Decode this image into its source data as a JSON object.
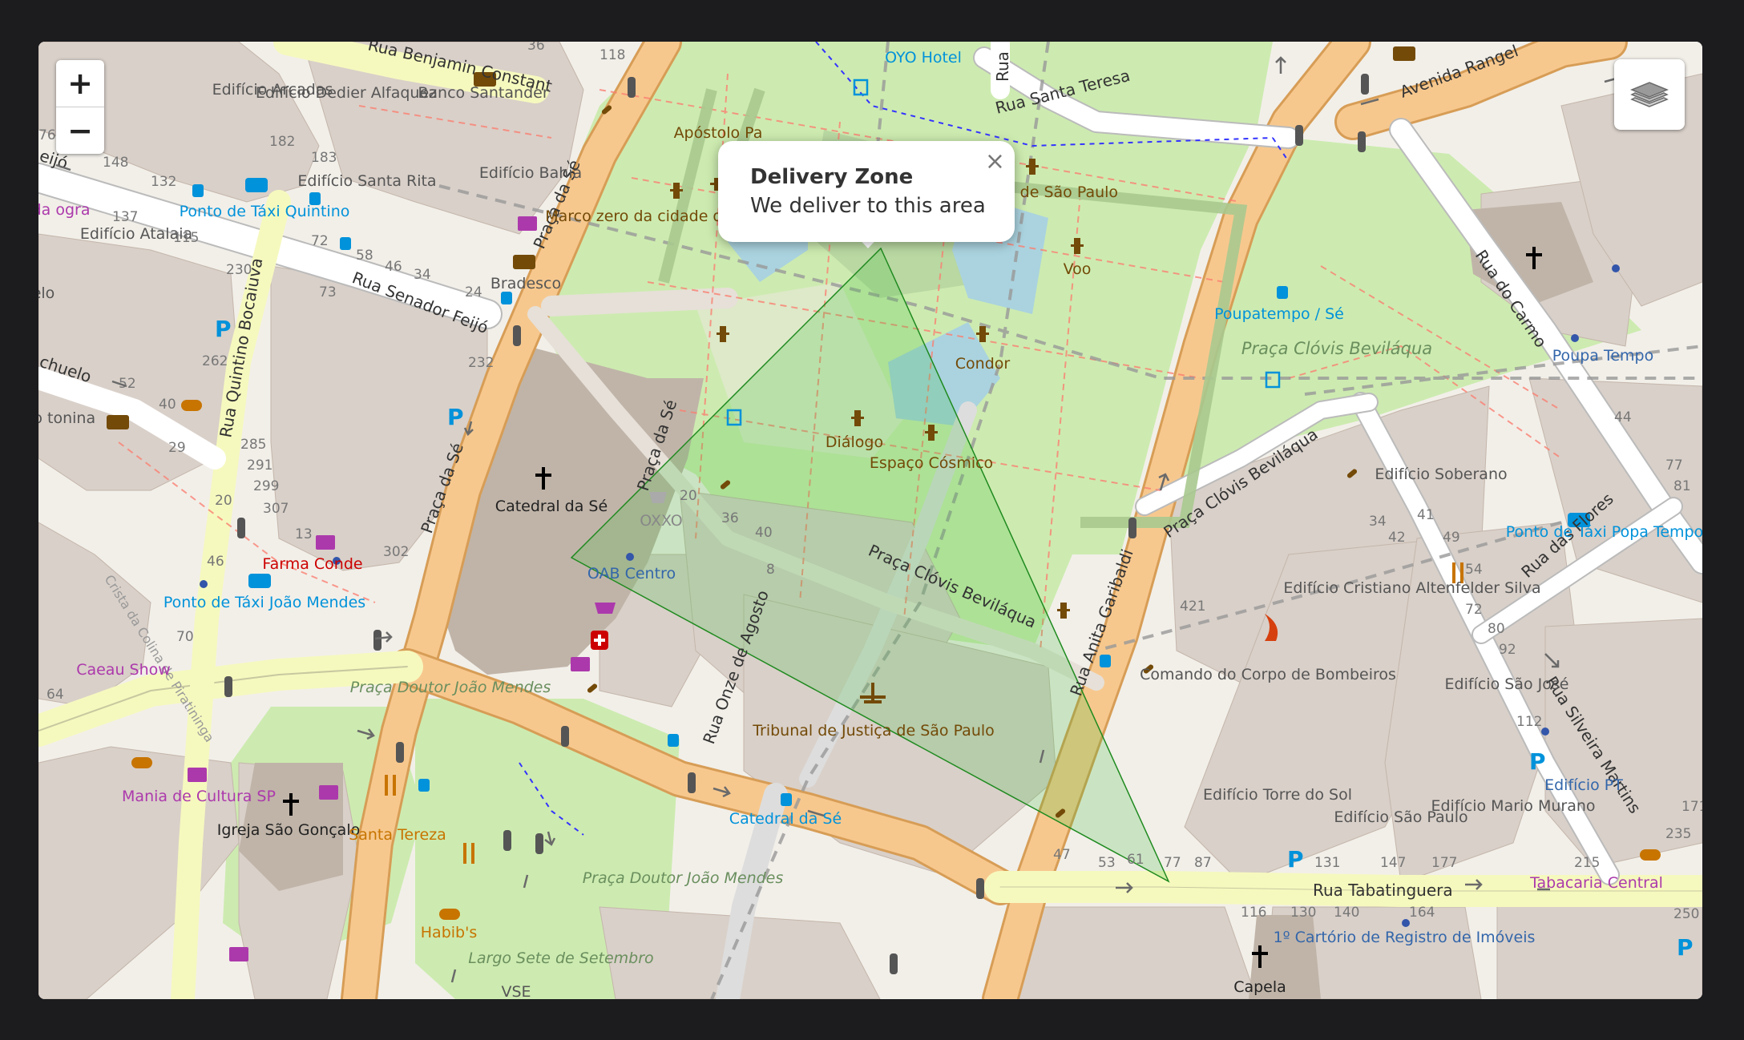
{
  "controls": {
    "zoom_in": "+",
    "zoom_out": "−",
    "layers_icon": "layers-icon"
  },
  "popup": {
    "title": "Delivery Zone",
    "text": "We deliver to this area",
    "close": "×"
  },
  "colors": {
    "polygon_fill": "#3bbf3b",
    "polygon_stroke": "#1f8a1f",
    "park": "#c8facc",
    "main_road": "#f7c88e",
    "secondary_road": "#f6f9be",
    "building": "#d9d0c9"
  },
  "streets": {
    "rua_benjamin_constant": "Rua Benjamin Constant",
    "rua_santa_teresa": "Rua Santa Teresa",
    "avenida_rangel": "Avenida Rangel",
    "rua_senador_feijo": "Rua Senador Feijó",
    "praca_da_se_a": "Praça da Sé",
    "praca_da_se_b": "Praça da Sé",
    "praca_da_se_c": "Praça da Sé",
    "rua_quintino_bocaiuva": "Rua Quintino Bocaiuva",
    "rua_do_carmo": "Rua do Carmo",
    "praca_clovis_bevilaqua_a": "Praça Clóvis Beviláqua",
    "praca_clovis_bevilaqua_b": "Praça Clóvis Beviláqua",
    "rua_anita_garibaldi": "Rua Anita Garibaldi",
    "rua_das_flores": "Rua das Flores",
    "rua_silveira_martins": "Rua Silveira Martins",
    "rua_onze_de_agosto": "Rua Onze de Agosto",
    "rua_tabatinguera": "Rua Tabatinguera",
    "rua_truncated": "Rua",
    "huelo": "chuelo",
    "feijo_cut": "eijó",
    "crista": "Crista da Colina de Piratininga"
  },
  "places": {
    "edificio_arcadas": "Edifício Arcadas",
    "edificio_dedier": "Edifício Dedier Alfaquez",
    "banco_santander": "Banco Santander",
    "edificio_bahia": "Edifício Bahia",
    "edificio_santa_rita": "Edifício Santa Rita",
    "edificio_atalaia": "Edifício Atalaia",
    "ponto_taxi_quintino": "Ponto de Táxi Quintino",
    "bradesco": "Bradesco",
    "apostolo_pa": "Apóstolo Pa",
    "marco_zero": "Marco zero da cidade de São Paulo",
    "oyo_hotel": "OYO Hotel",
    "emblema": "mblema de São Paulo",
    "voo": "Voo",
    "condor": "Condor",
    "dialogo": "Diálogo",
    "espaco_cosmico": "Espaço Cósmico",
    "catedral_da_se": "Catedral da Sé",
    "oxxo": "OXXO",
    "oab_centro": "OAB Centro",
    "poupatempo_se": "Poupatempo / Sé",
    "praca_clovis_park": "Praça Clóvis Beviláqua",
    "poupa_tempo": "Poupa Tempo",
    "edificio_soberano": "Edifício Soberano",
    "edificio_cristiano": "Edifício Cristiano Altenfelder Silva",
    "comando_bombeiros": "Comando do Corpo de Bombeiros",
    "edificio_sao_jose": "Edifício São José",
    "ponto_taxi_popa": "Ponto de Táxi Popa Tempo",
    "edificio_pt": "Edifício PT",
    "tribunal": "Tribunal de Justiça de São Paulo",
    "edificio_torre": "Edifício Torre do Sol",
    "edificio_sao_paulo": "Edifício São Paulo",
    "edificio_mario": "Edifício Mario Murano",
    "tabacaria": "Tabacaria Central",
    "capela": "Capela",
    "cartorio": "1º Cartório de Registro de Imóveis",
    "farma_conde": "Farma Conde",
    "ponto_taxi_joao": "Ponto de Táxi João Mendes",
    "caeau_show": "Caeau Show",
    "praca_joao_mendes_a": "Praça Doutor João Mendes",
    "praca_joao_mendes_b": "Praça Doutor João Mendes",
    "mania_cultura": "Mania de Cultura SP",
    "igreja_sao_goncalo": "Igreja São Gonçalo",
    "santa_tereza": "Santa Tereza",
    "habibs": "Habib's",
    "largo_sete": "Largo Sete de Setembro",
    "catedral_se_station": "Catedral da Sé",
    "cafe_da": "afé da ogra",
    "edio_tonina": "redio tonina",
    "elo": "elo",
    "vse": "VSE"
  },
  "numbers": [
    "36",
    "118",
    "76",
    "148",
    "132",
    "182",
    "183",
    "137",
    "115",
    "230",
    "72",
    "58",
    "46",
    "34",
    "24",
    "73",
    "262",
    "232",
    "52",
    "40",
    "29",
    "285",
    "291",
    "299",
    "20",
    "307",
    "13",
    "302",
    "46",
    "70",
    "64",
    "20",
    "36",
    "40",
    "8",
    "44",
    "77",
    "81",
    "34",
    "41",
    "42",
    "49",
    "54",
    "421",
    "72",
    "80",
    "92",
    "112",
    "171",
    "235",
    "47",
    "53",
    "61",
    "77",
    "87",
    "131",
    "147",
    "177",
    "215",
    "116",
    "130",
    "140",
    "164",
    "250"
  ]
}
